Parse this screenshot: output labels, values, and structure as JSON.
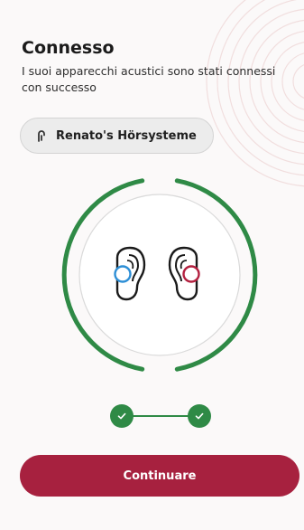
{
  "header": {
    "title": "Connesso",
    "subtitle": "I suoi apparecchi acustici sono stati connessi con successo"
  },
  "device": {
    "name": "Renato's Hörsysteme",
    "icon": "hearing-aid-icon"
  },
  "pairing": {
    "left_color": "#2e8fd6",
    "right_color": "#b3203f",
    "ring_color": "#2f8a46",
    "steps_completed": 2,
    "steps_total": 2
  },
  "actions": {
    "continue_label": "Continuare"
  },
  "colors": {
    "accent": "#a7213f",
    "success": "#2f8a46"
  }
}
